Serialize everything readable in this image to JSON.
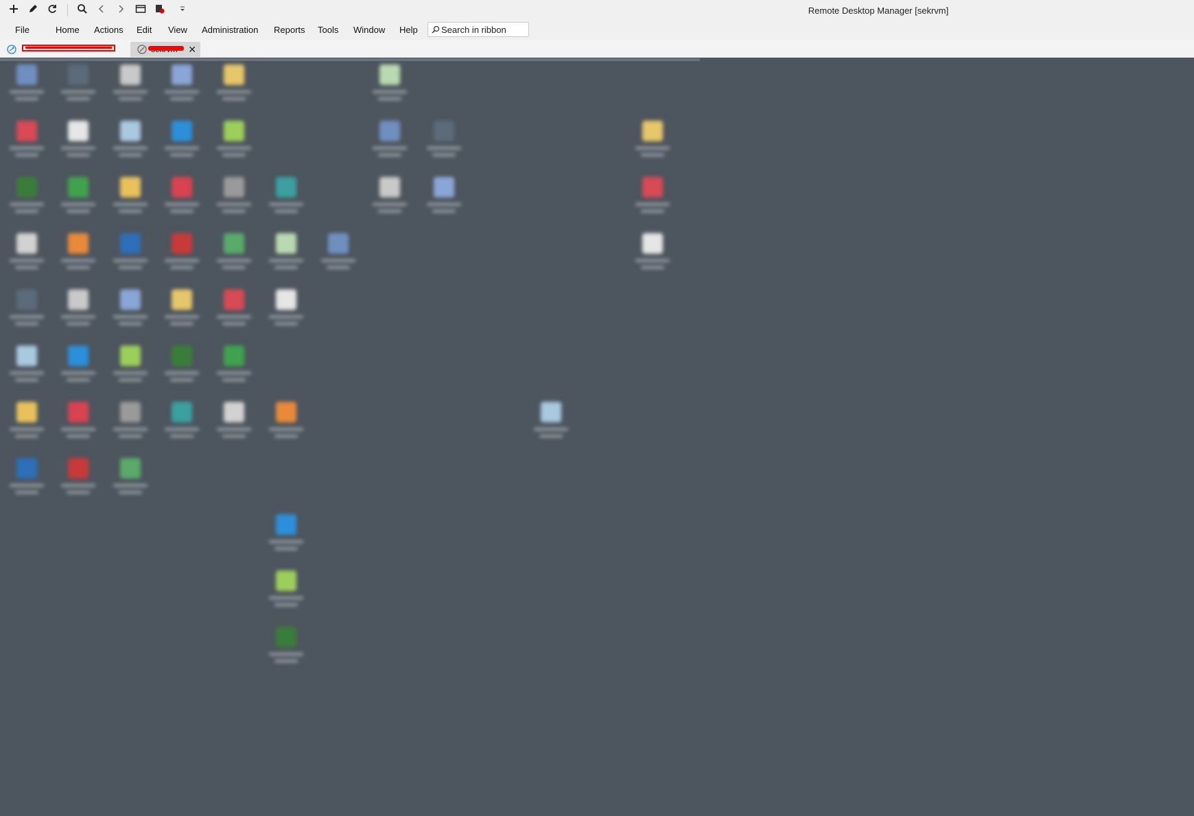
{
  "window": {
    "title": "Remote Desktop Manager [sekrvm]"
  },
  "quick_access": [
    {
      "icon": "plus-icon"
    },
    {
      "icon": "pencil-icon"
    },
    {
      "icon": "refresh-icon"
    },
    {
      "icon": "search-icon"
    },
    {
      "icon": "back-icon"
    },
    {
      "icon": "forward-icon"
    },
    {
      "icon": "window-icon"
    },
    {
      "icon": "record-icon"
    },
    {
      "icon": "customize-dropdown-icon"
    }
  ],
  "menu": {
    "items": [
      "File",
      "Home",
      "Actions",
      "Edit",
      "View",
      "Administration",
      "Reports",
      "Tools",
      "Window",
      "Help"
    ],
    "search_placeholder": "Search in ribbon"
  },
  "tabs": [
    {
      "icon": "remote-session-icon",
      "label": "",
      "redacted": true,
      "active": false
    },
    {
      "icon": "disconnected-session-icon",
      "label": "sekrvm",
      "redacted": true,
      "active": true
    }
  ],
  "desktop": {
    "background": "#4d555e",
    "icon_colors": [
      "#6f8fbf",
      "#5b6b7a",
      "#c9c9c9",
      "#8aa6d6",
      "#e6c76a",
      "#d84a55",
      "#e6e6e6",
      "#a8c9df",
      "#2b90d9",
      "#9bcf5a",
      "#3a7d3a",
      "#3fa34d",
      "#e9c15b",
      "#d9434f",
      "#9a9a9a",
      "#3aa0a0",
      "#d2d2d2",
      "#e88a3a",
      "#2d6fb8",
      "#c83a3a",
      "#5aaa6a",
      "#b9d9b0"
    ]
  }
}
